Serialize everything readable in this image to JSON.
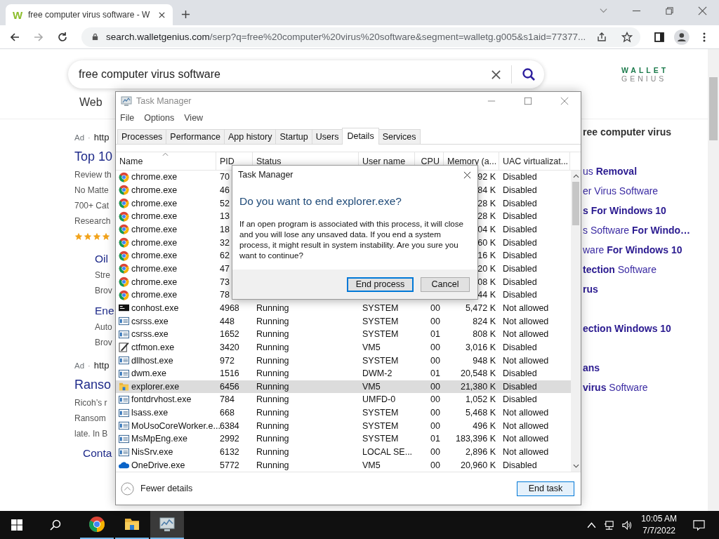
{
  "browser": {
    "tab": {
      "favicon": "W",
      "title": "free computer virus software - W"
    },
    "address": {
      "host": "search.walletgenius.com",
      "path": "/serp?q=free%20computer%20virus%20software&segment=walletg.g005&s1aid=77377..."
    },
    "search": {
      "value": "free computer virus software"
    },
    "logo": {
      "top": "WALLET",
      "bottom": "GENIUS"
    },
    "nav": [
      "Web"
    ],
    "results": [
      {
        "kind": "ad",
        "label": "Ad",
        "separator": "·",
        "url": "http"
      },
      {
        "kind": "title",
        "text": "Top 10"
      },
      {
        "kind": "line",
        "text": "Review th"
      },
      {
        "kind": "line",
        "text": "No Matte"
      },
      {
        "kind": "line",
        "text": "700+ Cat"
      },
      {
        "kind": "line",
        "text": "Research"
      },
      {
        "kind": "stars",
        "stars": 4
      },
      {
        "kind": "subtitle",
        "text": "Oil"
      },
      {
        "kind": "subline",
        "text": "Stre"
      },
      {
        "kind": "subline",
        "text": "Brov"
      },
      {
        "kind": "subtitle",
        "text": "Ene"
      },
      {
        "kind": "subline",
        "text": "Auto"
      },
      {
        "kind": "subline",
        "text": "Brov"
      },
      {
        "kind": "ad",
        "label": "Ad",
        "separator": "·",
        "url": "http"
      },
      {
        "kind": "title",
        "text": "Ranso"
      },
      {
        "kind": "line",
        "text": "Ricoh’s r"
      },
      {
        "kind": "line",
        "text": "Ransom"
      },
      {
        "kind": "line",
        "text": "late. In B"
      },
      {
        "kind": "link",
        "text": "Conta"
      }
    ],
    "related": {
      "heading": "ree computer virus",
      "groups": [
        [
          "us **Removal**",
          "er Virus Software",
          "**s For Windows 10**",
          "s Software **For Windo…**",
          "ware **For Windows 10**",
          "**tection** Software",
          "**rus**"
        ],
        [
          "**ection Windows 10**"
        ],
        [
          "**ans**",
          "**virus** Software"
        ]
      ]
    }
  },
  "task_manager": {
    "title": "Task Manager",
    "menu": [
      "File",
      "Options",
      "View"
    ],
    "tabs": [
      {
        "label": "Processes",
        "selected": false
      },
      {
        "label": "Performance",
        "selected": false
      },
      {
        "label": "App history",
        "selected": false
      },
      {
        "label": "Startup",
        "selected": false
      },
      {
        "label": "Users",
        "selected": false
      },
      {
        "label": "Details",
        "selected": true
      },
      {
        "label": "Services",
        "selected": false
      }
    ],
    "columns": [
      {
        "label": "Name",
        "sorted": true
      },
      {
        "label": "PID",
        "sorted": false
      },
      {
        "label": "Status",
        "sorted": false
      },
      {
        "label": "User name",
        "sorted": false
      },
      {
        "label": "CPU",
        "sorted": false
      },
      {
        "label": "Memory (a...",
        "sorted": false
      },
      {
        "label": "UAC virtualizat...",
        "sorted": false
      }
    ],
    "rows": [
      {
        "kind": "chrome",
        "name": "chrome.exe",
        "pid": "70",
        "memory": "92 K",
        "uac": "Disabled",
        "selected": false
      },
      {
        "kind": "chrome",
        "name": "chrome.exe",
        "pid": "46",
        "memory": "84 K",
        "uac": "Disabled",
        "selected": false
      },
      {
        "kind": "chrome",
        "name": "chrome.exe",
        "pid": "52",
        "memory": "28 K",
        "uac": "Disabled",
        "selected": false
      },
      {
        "kind": "chrome",
        "name": "chrome.exe",
        "pid": "13",
        "memory": "28 K",
        "uac": "Disabled",
        "selected": false
      },
      {
        "kind": "chrome",
        "name": "chrome.exe",
        "pid": "18",
        "memory": "04 K",
        "uac": "Disabled",
        "selected": false
      },
      {
        "kind": "chrome",
        "name": "chrome.exe",
        "pid": "32",
        "memory": "60 K",
        "uac": "Disabled",
        "selected": false
      },
      {
        "kind": "chrome",
        "name": "chrome.exe",
        "pid": "62",
        "memory": "16 K",
        "uac": "Disabled",
        "selected": false
      },
      {
        "kind": "chrome",
        "name": "chrome.exe",
        "pid": "47",
        "memory": "20 K",
        "uac": "Disabled",
        "selected": false
      },
      {
        "kind": "chrome",
        "name": "chrome.exe",
        "pid": "73",
        "memory": "08 K",
        "uac": "Disabled",
        "selected": false
      },
      {
        "kind": "chrome",
        "name": "chrome.exe",
        "pid": "78",
        "memory": "44 K",
        "uac": "Disabled",
        "selected": false
      },
      {
        "kind": "console",
        "name": "conhost.exe",
        "pid": "4968",
        "status": "Running",
        "user": "SYSTEM",
        "cpu": "00",
        "memory": "5,472 K",
        "uac": "Not allowed",
        "selected": false
      },
      {
        "kind": "app",
        "name": "csrss.exe",
        "pid": "448",
        "status": "Running",
        "user": "SYSTEM",
        "cpu": "00",
        "memory": "824 K",
        "uac": "Not allowed",
        "selected": false
      },
      {
        "kind": "app",
        "name": "csrss.exe",
        "pid": "1652",
        "status": "Running",
        "user": "SYSTEM",
        "cpu": "01",
        "memory": "808 K",
        "uac": "Not allowed",
        "selected": false
      },
      {
        "kind": "edit",
        "name": "ctfmon.exe",
        "pid": "3420",
        "status": "Running",
        "user": "VM5",
        "cpu": "00",
        "memory": "3,016 K",
        "uac": "Disabled",
        "selected": false
      },
      {
        "kind": "app",
        "name": "dllhost.exe",
        "pid": "972",
        "status": "Running",
        "user": "SYSTEM",
        "cpu": "00",
        "memory": "948 K",
        "uac": "Not allowed",
        "selected": false
      },
      {
        "kind": "app",
        "name": "dwm.exe",
        "pid": "1516",
        "status": "Running",
        "user": "DWM-2",
        "cpu": "01",
        "memory": "20,548 K",
        "uac": "Disabled",
        "selected": false
      },
      {
        "kind": "folder",
        "name": "explorer.exe",
        "pid": "6456",
        "status": "Running",
        "user": "VM5",
        "cpu": "00",
        "memory": "21,380 K",
        "uac": "Disabled",
        "selected": true
      },
      {
        "kind": "app",
        "name": "fontdrvhost.exe",
        "pid": "784",
        "status": "Running",
        "user": "UMFD-0",
        "cpu": "00",
        "memory": "1,052 K",
        "uac": "Disabled",
        "selected": false
      },
      {
        "kind": "app",
        "name": "lsass.exe",
        "pid": "668",
        "status": "Running",
        "user": "SYSTEM",
        "cpu": "00",
        "memory": "5,468 K",
        "uac": "Not allowed",
        "selected": false
      },
      {
        "kind": "app",
        "name": "MoUsoCoreWorker.e...",
        "pid": "6384",
        "status": "Running",
        "user": "SYSTEM",
        "cpu": "00",
        "memory": "496 K",
        "uac": "Not allowed",
        "selected": false
      },
      {
        "kind": "app",
        "name": "MsMpEng.exe",
        "pid": "2992",
        "status": "Running",
        "user": "SYSTEM",
        "cpu": "01",
        "memory": "183,396 K",
        "uac": "Not allowed",
        "selected": false
      },
      {
        "kind": "app",
        "name": "NisSrv.exe",
        "pid": "6132",
        "status": "Running",
        "user": "LOCAL SE...",
        "cpu": "00",
        "memory": "2,896 K",
        "uac": "Not allowed",
        "selected": false
      },
      {
        "kind": "cloud",
        "name": "OneDrive.exe",
        "pid": "5772",
        "status": "Running",
        "user": "VM5",
        "cpu": "00",
        "memory": "20,960 K",
        "uac": "Disabled",
        "selected": false
      }
    ],
    "fewer_details": "Fewer details",
    "end_task": "End task",
    "dialog": {
      "title": "Task Manager",
      "question": "Do you want to end explorer.exe?",
      "message": "If an open program is associated with this process, it will close and you will lose any unsaved data. If you end a system process, it might result in system instability. Are you sure you want to continue?",
      "buttons": [
        {
          "label": "End process",
          "default": true
        },
        {
          "label": "Cancel",
          "default": false
        }
      ]
    }
  },
  "taskbar": {
    "apps": [
      {
        "kind": "chrome",
        "selected": false
      },
      {
        "kind": "folder",
        "selected": false
      },
      {
        "kind": "taskmanager",
        "selected": true
      }
    ],
    "time": "10:05 AM",
    "date": "7/7/2022"
  }
}
